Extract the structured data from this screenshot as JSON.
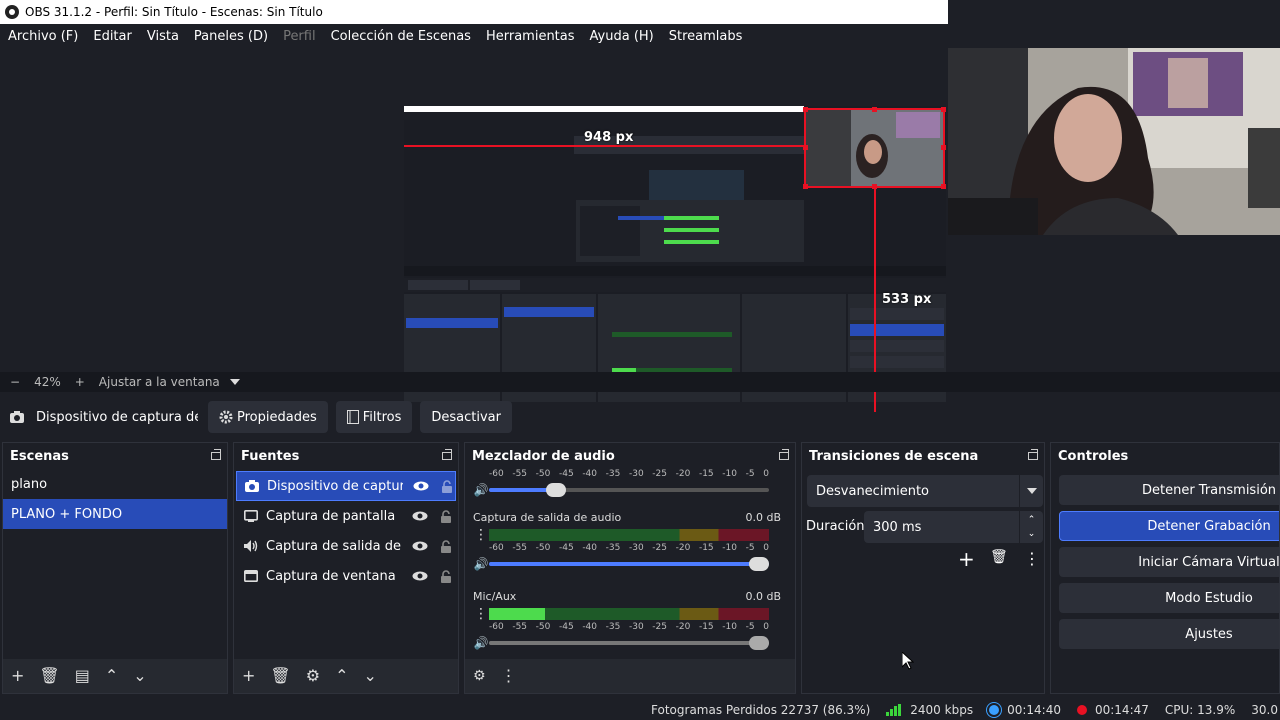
{
  "window": {
    "title": "OBS 31.1.2 - Perfil: Sin Título - Escenas: Sin Título"
  },
  "menu": [
    "Archivo (F)",
    "Editar",
    "Vista",
    "Paneles (D)",
    "Perfil",
    "Colección de Escenas",
    "Herramientas",
    "Ayuda (H)",
    "Streamlabs"
  ],
  "preview": {
    "measure_top": "948 px",
    "measure_right": "533 px"
  },
  "zoom": {
    "minus": "−",
    "value": "42%",
    "plus": "+",
    "fit": "Ajustar a la ventana"
  },
  "source_toolbar": {
    "source_name": "Dispositivo de captura de v",
    "properties": "Propiedades",
    "filters": "Filtros",
    "deactivate": "Desactivar"
  },
  "scenes": {
    "title": "Escenas",
    "items": [
      "plano",
      "PLANO + FONDO"
    ],
    "selected": 1
  },
  "sources": {
    "title": "Fuentes",
    "items": [
      {
        "label": "Dispositivo de captura",
        "icon": "camera-icon"
      },
      {
        "label": "Captura de pantalla",
        "icon": "monitor-icon"
      },
      {
        "label": "Captura de salida de au",
        "icon": "speaker-icon"
      },
      {
        "label": "Captura de ventana",
        "icon": "window-icon"
      }
    ]
  },
  "mixer": {
    "title": "Mezclador de audio",
    "scale": [
      "-60",
      "-55",
      "-50",
      "-45",
      "-40",
      "-35",
      "-30",
      "-25",
      "-20",
      "-15",
      "-10",
      "-5",
      "0"
    ],
    "channels": [
      {
        "name": "",
        "db": "",
        "level": 0,
        "volume": 0.24
      },
      {
        "name": "Captura de salida de audio",
        "db": "0.0 dB",
        "level": 0,
        "volume": 1.0
      },
      {
        "name": "Mic/Aux",
        "db": "0.0 dB",
        "level": 0.2,
        "volume": 1.0
      }
    ]
  },
  "transitions": {
    "title": "Transiciones de escena",
    "type": "Desvanecimiento",
    "duration_label": "Duración",
    "duration_value": "300 ms"
  },
  "controls": {
    "title": "Controles",
    "buttons": [
      "Detener Transmisión",
      "Detener Grabación",
      "Iniciar Cámara Virtual",
      "Modo Estudio",
      "Ajustes"
    ],
    "active": 1
  },
  "status": {
    "dropped": "Fotogramas Perdidos 22737 (86.3%)",
    "bitrate": "2400 kbps",
    "stream_time": "00:14:40",
    "rec_time": "00:14:47",
    "cpu": "CPU: 13.9%",
    "fps": "30.0"
  },
  "colors": {
    "accent": "#284cb8",
    "rec": "#e81123",
    "meter_green": "#4ddb4d"
  }
}
